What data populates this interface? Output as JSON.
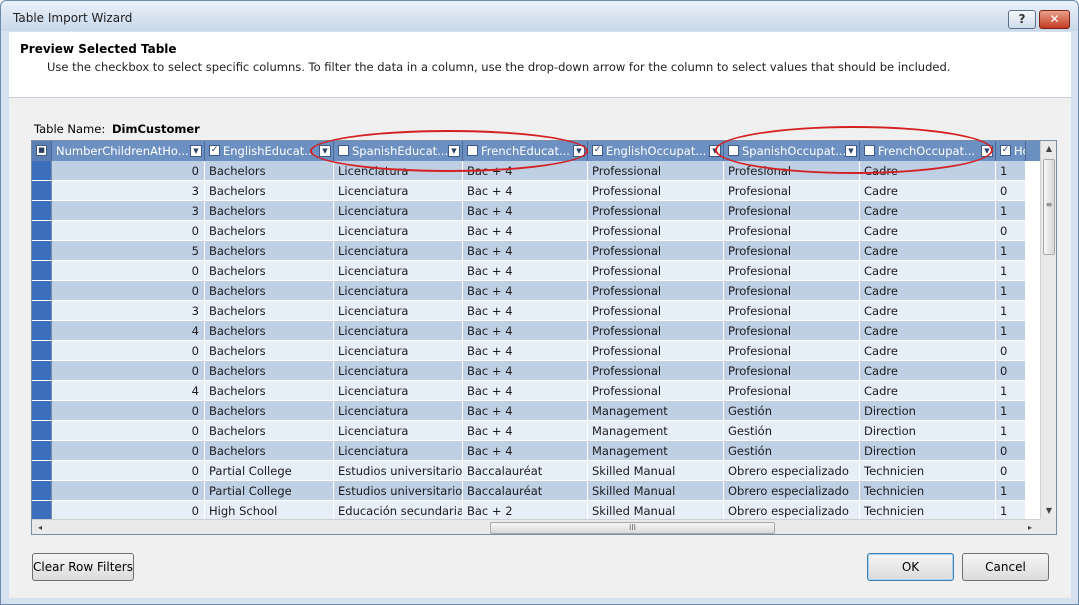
{
  "window": {
    "title": "Table Import Wizard",
    "help_label": "?",
    "close_label": "✕"
  },
  "header": {
    "title": "Preview Selected Table",
    "subtitle": "Use the checkbox to select specific columns. To filter the data in a column, use the drop-down arrow  for the column to select values that should be included."
  },
  "table_name": {
    "label": "Table Name:",
    "value": "DimCustomer"
  },
  "columns": [
    {
      "label": "NumberChildrenAtHo...",
      "checked": null
    },
    {
      "label": "EnglishEducat...",
      "checked": true
    },
    {
      "label": "SpanishEducat...",
      "checked": false
    },
    {
      "label": "FrenchEducat...",
      "checked": false
    },
    {
      "label": "EnglishOccupat...",
      "checked": true
    },
    {
      "label": "SpanishOccupat...",
      "checked": false
    },
    {
      "label": "FrenchOccupat...",
      "checked": false
    },
    {
      "label": "Ho",
      "checked": true
    }
  ],
  "rows": [
    [
      "0",
      "Bachelors",
      "Licenciatura",
      "Bac + 4",
      "Professional",
      "Profesional",
      "Cadre",
      "1"
    ],
    [
      "3",
      "Bachelors",
      "Licenciatura",
      "Bac + 4",
      "Professional",
      "Profesional",
      "Cadre",
      "0"
    ],
    [
      "3",
      "Bachelors",
      "Licenciatura",
      "Bac + 4",
      "Professional",
      "Profesional",
      "Cadre",
      "1"
    ],
    [
      "0",
      "Bachelors",
      "Licenciatura",
      "Bac + 4",
      "Professional",
      "Profesional",
      "Cadre",
      "0"
    ],
    [
      "5",
      "Bachelors",
      "Licenciatura",
      "Bac + 4",
      "Professional",
      "Profesional",
      "Cadre",
      "1"
    ],
    [
      "0",
      "Bachelors",
      "Licenciatura",
      "Bac + 4",
      "Professional",
      "Profesional",
      "Cadre",
      "1"
    ],
    [
      "0",
      "Bachelors",
      "Licenciatura",
      "Bac + 4",
      "Professional",
      "Profesional",
      "Cadre",
      "1"
    ],
    [
      "3",
      "Bachelors",
      "Licenciatura",
      "Bac + 4",
      "Professional",
      "Profesional",
      "Cadre",
      "1"
    ],
    [
      "4",
      "Bachelors",
      "Licenciatura",
      "Bac + 4",
      "Professional",
      "Profesional",
      "Cadre",
      "1"
    ],
    [
      "0",
      "Bachelors",
      "Licenciatura",
      "Bac + 4",
      "Professional",
      "Profesional",
      "Cadre",
      "0"
    ],
    [
      "0",
      "Bachelors",
      "Licenciatura",
      "Bac + 4",
      "Professional",
      "Profesional",
      "Cadre",
      "0"
    ],
    [
      "4",
      "Bachelors",
      "Licenciatura",
      "Bac + 4",
      "Professional",
      "Profesional",
      "Cadre",
      "1"
    ],
    [
      "0",
      "Bachelors",
      "Licenciatura",
      "Bac + 4",
      "Management",
      "Gestión",
      "Direction",
      "1"
    ],
    [
      "0",
      "Bachelors",
      "Licenciatura",
      "Bac + 4",
      "Management",
      "Gestión",
      "Direction",
      "1"
    ],
    [
      "0",
      "Bachelors",
      "Licenciatura",
      "Bac + 4",
      "Management",
      "Gestión",
      "Direction",
      "0"
    ],
    [
      "0",
      "Partial College",
      "Estudios universitario...",
      "Baccalauréat",
      "Skilled Manual",
      "Obrero especializado",
      "Technicien",
      "0"
    ],
    [
      "0",
      "Partial College",
      "Estudios universitario...",
      "Baccalauréat",
      "Skilled Manual",
      "Obrero especializado",
      "Technicien",
      "1"
    ],
    [
      "0",
      "High School",
      "Educación secundaria",
      "Bac + 2",
      "Skilled Manual",
      "Obrero especializado",
      "Technicien",
      "1"
    ]
  ],
  "scrollbar": {
    "up": "▲",
    "down": "▼",
    "left": "◂",
    "right": "▸",
    "grip_v": "≡",
    "grip_h": "III"
  },
  "buttons": {
    "clear_row_filters": "Clear Row Filters",
    "ok": "OK",
    "cancel": "Cancel"
  },
  "colors": {
    "header_bg": "#6c90c1",
    "row_odd": "#bfd0e5",
    "row_even": "#e6eef8",
    "highlight": "#d42020"
  }
}
